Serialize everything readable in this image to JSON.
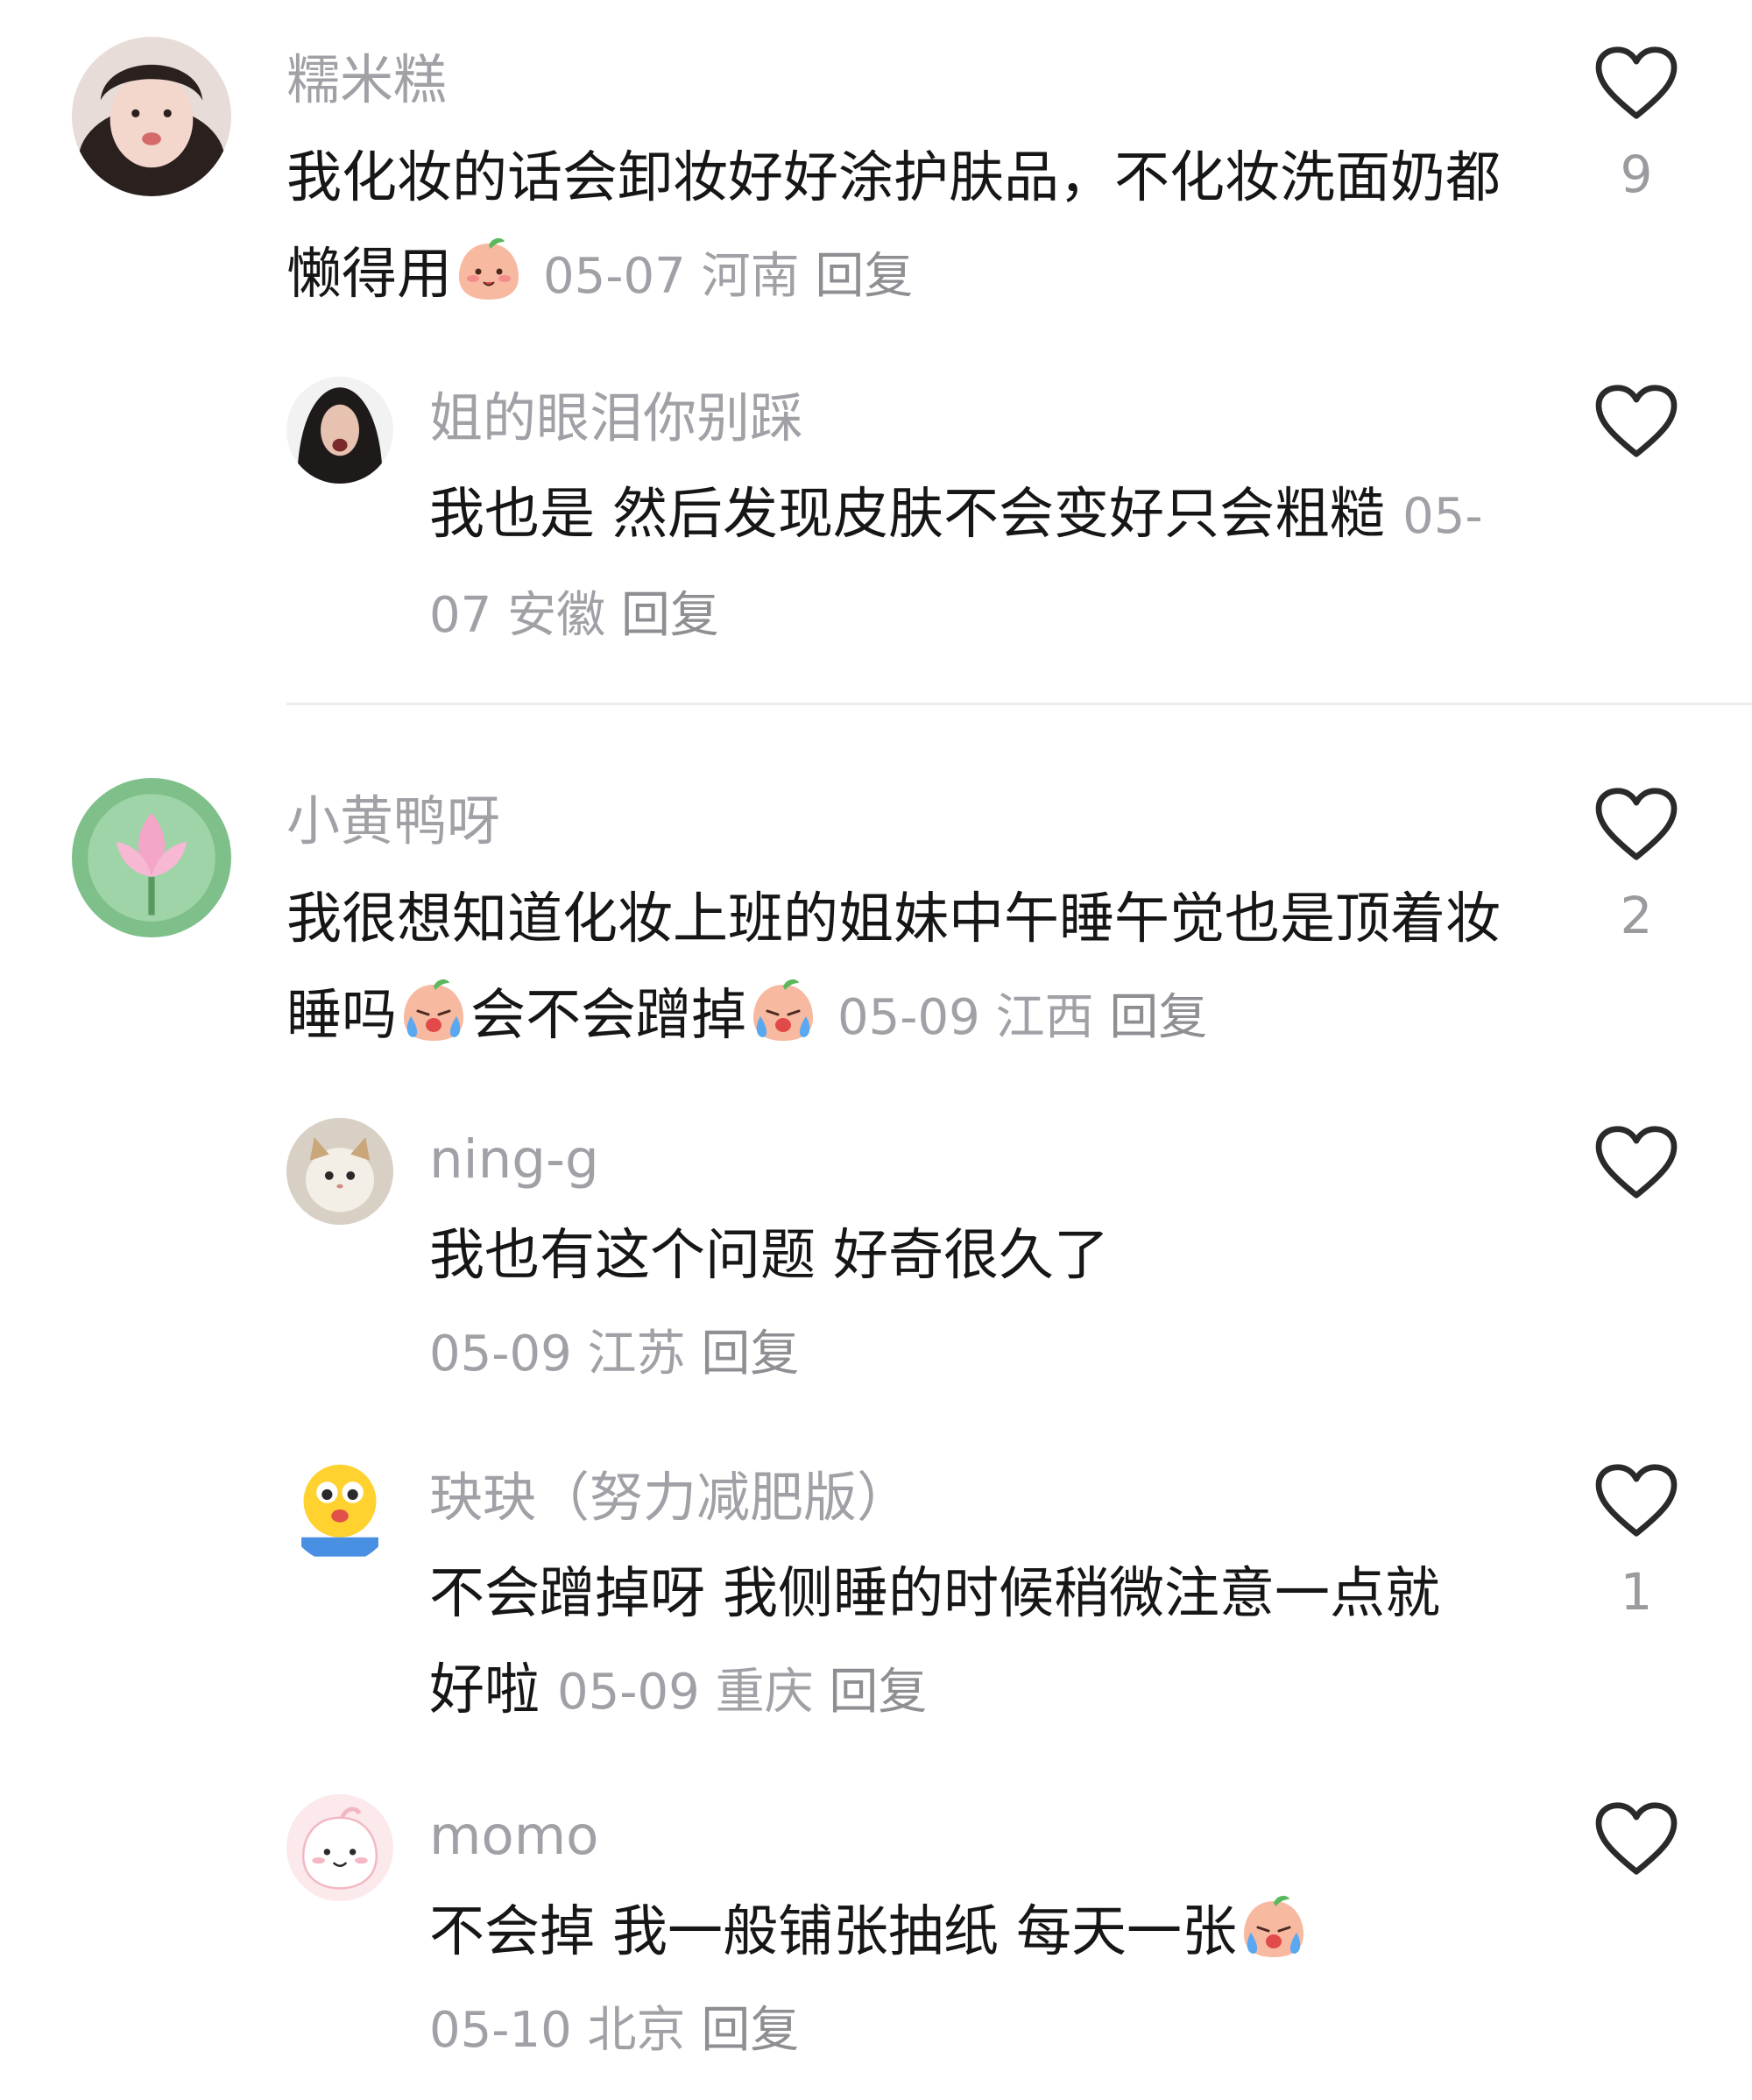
{
  "comments": [
    {
      "username": "糯米糕",
      "text": "我化妆的话会卸妆好好涂护肤品，不化妆洗面奶都懒得用",
      "emoji": "smile-emoji",
      "date": "05-07",
      "location": "河南",
      "reply_label": "回复",
      "likes": "9",
      "replies": [
        {
          "username": "姐的眼泪你别踩",
          "text": "我也是 然后发现皮肤不会变好只会粗糙",
          "date": "05-07",
          "location": "安徽",
          "reply_label": "回复"
        }
      ]
    },
    {
      "username": "小黄鸭呀",
      "text_parts": [
        "我很想知道化妆上班的姐妹中午睡午觉也是顶着妆睡吗",
        "会不会蹭掉"
      ],
      "emoji": "crying-emoji",
      "date": "05-09",
      "location": "江西",
      "reply_label": "回复",
      "likes": "2",
      "replies": [
        {
          "username": "ning-g",
          "text": "我也有这个问题 好奇很久了",
          "date": "05-09",
          "location": "江苏",
          "reply_label": "回复"
        },
        {
          "username": "玦玦（努力减肥版）",
          "text": "不会蹭掉呀  我侧睡的时候稍微注意一点就好啦",
          "date": "05-09",
          "location": "重庆",
          "reply_label": "回复",
          "likes": "1"
        },
        {
          "username": "momo",
          "text": "不会掉 我一般铺张抽纸 每天一张",
          "emoji": "crying-emoji",
          "date": "05-10",
          "location": "北京",
          "reply_label": "回复"
        }
      ]
    }
  ],
  "colors": {
    "username": "#a0a0a6",
    "text": "#161616",
    "heart_outline": "#2a2a2a",
    "divider": "#ececee"
  }
}
